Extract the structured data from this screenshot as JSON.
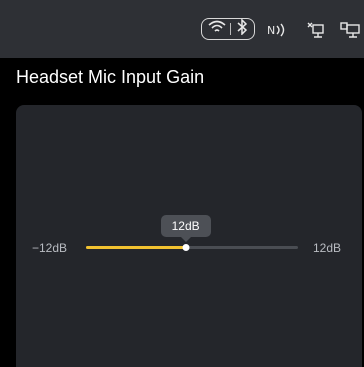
{
  "status_bar": {
    "icons": [
      "wifi-icon",
      "bluetooth-icon",
      "nfc-icon",
      "network-icon",
      "display-icon"
    ]
  },
  "title": "Headset Mic Input Gain",
  "slider": {
    "min_label": "−12dB",
    "max_label": "12dB",
    "value_label": "12dB",
    "fraction": 0.47
  },
  "colors": {
    "accent": "#f2c230",
    "status_bar_bg": "#2e3035",
    "panel_bg": "#24262b"
  }
}
